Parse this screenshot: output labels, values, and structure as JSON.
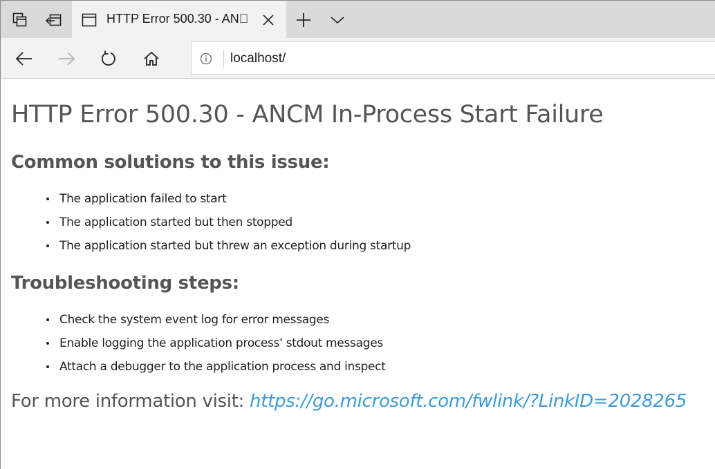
{
  "browser": {
    "tab": {
      "title": "HTTP Error 500.30 - AN\u0000"
    },
    "address": {
      "url": "localhost/"
    },
    "icons": {
      "tab_manager": "set-aside-tabs-icon",
      "restore_tabs": "restore-tabs-icon",
      "page": "page-icon",
      "close": "close-icon",
      "new_tab": "plus-icon",
      "tab_list": "chevron-down-icon",
      "back": "back-arrow-icon",
      "forward": "forward-arrow-icon",
      "refresh": "refresh-icon",
      "home": "home-icon",
      "site_info": "info-icon"
    }
  },
  "page": {
    "title": "HTTP Error 500.30 - ANCM In-Process Start Failure",
    "common_heading": "Common solutions to this issue:",
    "common_items": [
      "The application failed to start",
      "The application started but then stopped",
      "The application started but threw an exception during startup"
    ],
    "troubleshooting_heading": "Troubleshooting steps:",
    "troubleshooting_items": [
      "Check the system event log for error messages",
      "Enable logging the application process' stdout messages",
      "Attach a debugger to the application process and inspect"
    ],
    "more_info_label": "For more information visit:",
    "more_info_link": "https://go.microsoft.com/fwlink/?LinkID=2028265"
  },
  "colors": {
    "link": "#3c9bd8",
    "heading": "#555555",
    "tabstrip": "#dadada",
    "toolbar": "#f2f2f2"
  }
}
